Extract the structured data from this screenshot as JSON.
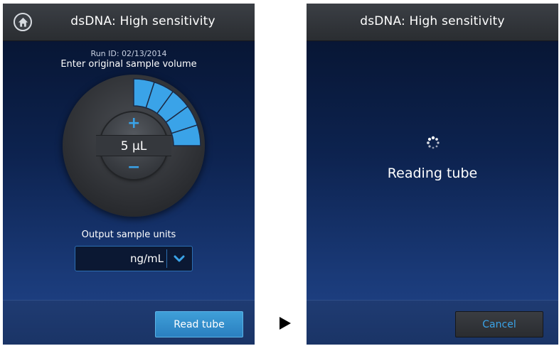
{
  "left_screen": {
    "title": "dsDNA: High sensitivity",
    "run_id": "Run ID: 02/13/2014",
    "prompt": "Enter original sample volume",
    "dial": {
      "value": "5 µL",
      "increment_symbol": "+",
      "decrement_symbol": "−",
      "segments_total": 16,
      "segments_filled": 5,
      "fill_color": "#3aa3e8"
    },
    "output_label": "Output sample units",
    "unit_select": {
      "selected": "ng/mL"
    },
    "primary_button": "Read tube",
    "icons": {
      "home": "home-icon",
      "dropdown": "chevron-down-icon"
    }
  },
  "right_screen": {
    "title": "dsDNA: High sensitivity",
    "status": "Reading tube",
    "cancel_button": "Cancel",
    "icons": {
      "spinner": "spinner-icon"
    }
  },
  "flow_arrow": "arrow-right-icon",
  "colors": {
    "accent": "#3aa3e8",
    "titlebar": "#2f3236"
  }
}
